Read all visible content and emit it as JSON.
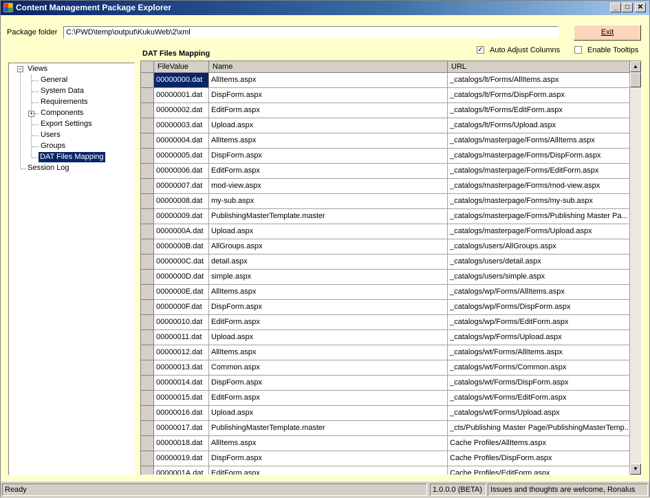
{
  "window": {
    "title": "Content Management Package Explorer"
  },
  "package_folder": {
    "label": "Package folder",
    "value": "C:\\PWD\\temp\\output\\KukuWeb\\2\\xml"
  },
  "exit_label": "Exit",
  "section_title": "DAT Files Mapping",
  "options": {
    "auto_adjust_label": "Auto Adjust Columns",
    "auto_adjust_checked": true,
    "tooltips_label": "Enable Tooltips",
    "tooltips_checked": false
  },
  "tree": {
    "root": "Views",
    "children": [
      "General",
      "System Data",
      "Requirements",
      "Components",
      "Export Settings",
      "Users",
      "Groups",
      "DAT Files Mapping"
    ],
    "selected": "DAT Files Mapping",
    "sibling": "Session Log"
  },
  "grid": {
    "columns": [
      "FileValue",
      "Name",
      "URL"
    ],
    "rows": [
      [
        "00000000.dat",
        "AllItems.aspx",
        "_catalogs/lt/Forms/AllItems.aspx"
      ],
      [
        "00000001.dat",
        "DispForm.aspx",
        "_catalogs/lt/Forms/DispForm.aspx"
      ],
      [
        "00000002.dat",
        "EditForm.aspx",
        "_catalogs/lt/Forms/EditForm.aspx"
      ],
      [
        "00000003.dat",
        "Upload.aspx",
        "_catalogs/lt/Forms/Upload.aspx"
      ],
      [
        "00000004.dat",
        "AllItems.aspx",
        "_catalogs/masterpage/Forms/AllItems.aspx"
      ],
      [
        "00000005.dat",
        "DispForm.aspx",
        "_catalogs/masterpage/Forms/DispForm.aspx"
      ],
      [
        "00000006.dat",
        "EditForm.aspx",
        "_catalogs/masterpage/Forms/EditForm.aspx"
      ],
      [
        "00000007.dat",
        "mod-view.aspx",
        "_catalogs/masterpage/Forms/mod-view.aspx"
      ],
      [
        "00000008.dat",
        "my-sub.aspx",
        "_catalogs/masterpage/Forms/my-sub.aspx"
      ],
      [
        "00000009.dat",
        "PublishingMasterTemplate.master",
        "_catalogs/masterpage/Forms/Publishing Master Pa..."
      ],
      [
        "0000000A.dat",
        "Upload.aspx",
        "_catalogs/masterpage/Forms/Upload.aspx"
      ],
      [
        "0000000B.dat",
        "AllGroups.aspx",
        "_catalogs/users/AllGroups.aspx"
      ],
      [
        "0000000C.dat",
        "detail.aspx",
        "_catalogs/users/detail.aspx"
      ],
      [
        "0000000D.dat",
        "simple.aspx",
        "_catalogs/users/simple.aspx"
      ],
      [
        "0000000E.dat",
        "AllItems.aspx",
        "_catalogs/wp/Forms/AllItems.aspx"
      ],
      [
        "0000000F.dat",
        "DispForm.aspx",
        "_catalogs/wp/Forms/DispForm.aspx"
      ],
      [
        "00000010.dat",
        "EditForm.aspx",
        "_catalogs/wp/Forms/EditForm.aspx"
      ],
      [
        "00000011.dat",
        "Upload.aspx",
        "_catalogs/wp/Forms/Upload.aspx"
      ],
      [
        "00000012.dat",
        "AllItems.aspx",
        "_catalogs/wt/Forms/AllItems.aspx"
      ],
      [
        "00000013.dat",
        "Common.aspx",
        "_catalogs/wt/Forms/Common.aspx"
      ],
      [
        "00000014.dat",
        "DispForm.aspx",
        "_catalogs/wt/Forms/DispForm.aspx"
      ],
      [
        "00000015.dat",
        "EditForm.aspx",
        "_catalogs/wt/Forms/EditForm.aspx"
      ],
      [
        "00000016.dat",
        "Upload.aspx",
        "_catalogs/wt/Forms/Upload.aspx"
      ],
      [
        "00000017.dat",
        "PublishingMasterTemplate.master",
        "_cts/Publishing Master Page/PublishingMasterTemp..."
      ],
      [
        "00000018.dat",
        "AllItems.aspx",
        "Cache Profiles/AllItems.aspx"
      ],
      [
        "00000019.dat",
        "DispForm.aspx",
        "Cache Profiles/DispForm.aspx"
      ],
      [
        "0000001A.dat",
        "EditForm.aspx",
        "Cache Profiles/EditForm.aspx"
      ]
    ]
  },
  "status": {
    "left": "Ready",
    "version": "1.0.0.0 (BETA)",
    "message": "Issues and thoughts are welcome,  Ronalus"
  },
  "colors": {
    "title_active": "#0a246a",
    "selection": "#0a246a",
    "client_bg": "#ffffcc",
    "exit_bg": "#fbd6b8"
  }
}
